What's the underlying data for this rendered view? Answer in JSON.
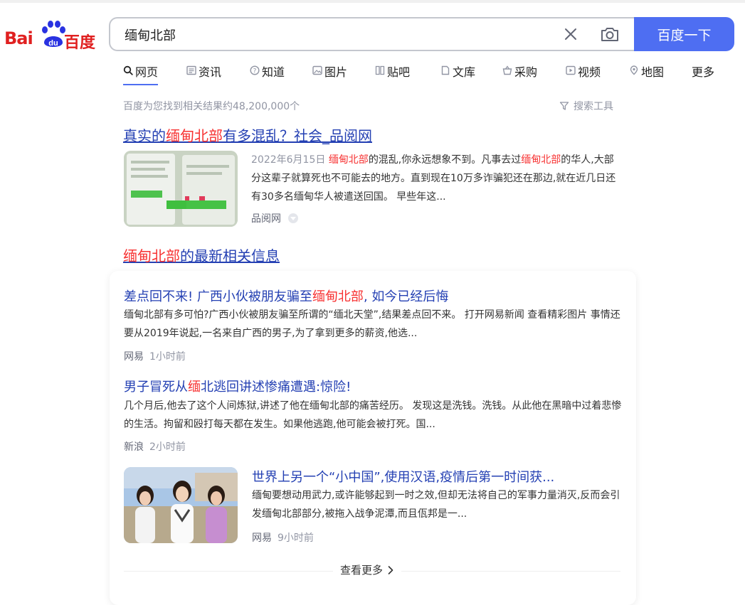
{
  "logo": {
    "latin": "Bai",
    "du": "du",
    "chinese": "百度"
  },
  "search": {
    "query": "缅甸北部",
    "button_label": "百度一下"
  },
  "tabs": [
    {
      "label": "网页",
      "icon": "search-icon"
    },
    {
      "label": "资讯",
      "icon": "news-icon"
    },
    {
      "label": "知道",
      "icon": "question-icon"
    },
    {
      "label": "图片",
      "icon": "image-icon"
    },
    {
      "label": "贴吧",
      "icon": "tieba-icon"
    },
    {
      "label": "文库",
      "icon": "document-icon"
    },
    {
      "label": "采购",
      "icon": "basket-icon"
    },
    {
      "label": "视频",
      "icon": "video-icon"
    },
    {
      "label": "地图",
      "icon": "map-icon"
    },
    {
      "label": "更多",
      "icon": ""
    }
  ],
  "result_count": "百度为您找到相关结果约48,200,000个",
  "search_tools": "搜索工具",
  "result1": {
    "title_pre": "真实的",
    "title_hl": "缅甸北部",
    "title_post": "有多混乱？社会_品阅网",
    "date": "2022年6月15日",
    "snippet_hl1": "缅甸北部",
    "snippet_mid": "的混乱,你永远想象不到。凡事去过",
    "snippet_hl2": "缅甸北部",
    "snippet_rest": "的华人,大部分这辈子就算死也不可能去的地方。直到现在10万多诈骗犯还在那边,就在近几日还有30多名缅甸华人被遣送回国。 早些年这...",
    "source": "品阅网"
  },
  "news_heading": {
    "hl": "缅甸北部",
    "rest": "的最新相关信息"
  },
  "news": [
    {
      "title_pre": "差点回不来! 广西小伙被朋友骗至",
      "title_hl": "缅甸北部",
      "title_post": ", 如今已经后悔",
      "snippet": "缅甸北部有多可怕?广西小伙被朋友骗至所谓的“缅北天堂”,结果差点回不来。 打开网易新闻 查看精彩图片 事情还要从2019年说起,一名来自广西的男子,为了拿到更多的薪资,他选...",
      "source": "网易",
      "time": "1小时前"
    },
    {
      "title_pre": "男子冒死从",
      "title_hl": "缅",
      "title_post": "北逃回讲述惨痛遭遇:惊险!",
      "snippet": "几个月后,他去了这个人间炼狱,讲述了他在缅甸北部的痛苦经历。 发现这是洗钱。洗钱。从此他在黑暗中过着悲惨的生活。拘留和殴打每天都在发生。如果他逃跑,他可能会被打死。国...",
      "source": "新浪",
      "time": "2小时前"
    },
    {
      "title_pre": "世界上另一个“小中国”,使用汉语,疫情后第一时间获...",
      "title_hl": "",
      "title_post": "",
      "snippet": "缅甸要想动用武力,或许能够起到一时之效,但却无法将自己的军事力量消灭,反而会引发缅甸北部部分,被拖入战争泥潭,而且佤邦是一...",
      "source": "网易",
      "time": "9小时前"
    }
  ],
  "see_more": "查看更多",
  "colors": {
    "accent": "#4e6ef2",
    "link": "#2440b3",
    "highlight": "#f73131",
    "muted": "#9195a3"
  }
}
